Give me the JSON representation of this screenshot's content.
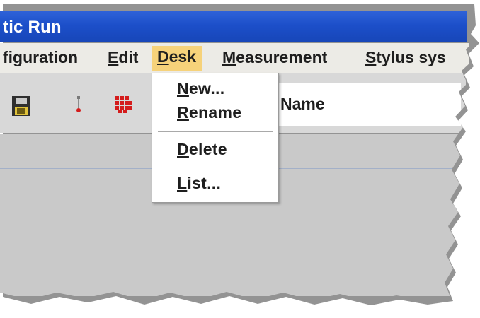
{
  "window": {
    "title": "tic Run"
  },
  "menubar": {
    "items": [
      {
        "label": "figuration"
      },
      {
        "label_pre": "",
        "mnemonic": "E",
        "label_post": "dit"
      },
      {
        "label_pre": "",
        "mnemonic": "D",
        "label_post": "esk"
      },
      {
        "label_pre": "",
        "mnemonic": "M",
        "label_post": "easurement"
      },
      {
        "label_pre": "",
        "mnemonic": "S",
        "label_post": "tylus sys"
      }
    ]
  },
  "toolbar": {
    "icons": [
      "save-icon",
      "probe-icon",
      "grid-icon"
    ],
    "name_label": "Name"
  },
  "dropdown": {
    "items": [
      {
        "mnemonic": "N",
        "rest": "ew..."
      },
      {
        "mnemonic": "R",
        "rest": "ename"
      },
      {
        "mnemonic": "D",
        "rest": "elete"
      },
      {
        "mnemonic": "L",
        "rest": "ist..."
      }
    ]
  },
  "colors": {
    "titlebar": "#1c4fc9",
    "menu_highlight": "#f6d27a",
    "toolbar_bg": "#d8d8d8",
    "content_bg": "#c9c9c9"
  }
}
